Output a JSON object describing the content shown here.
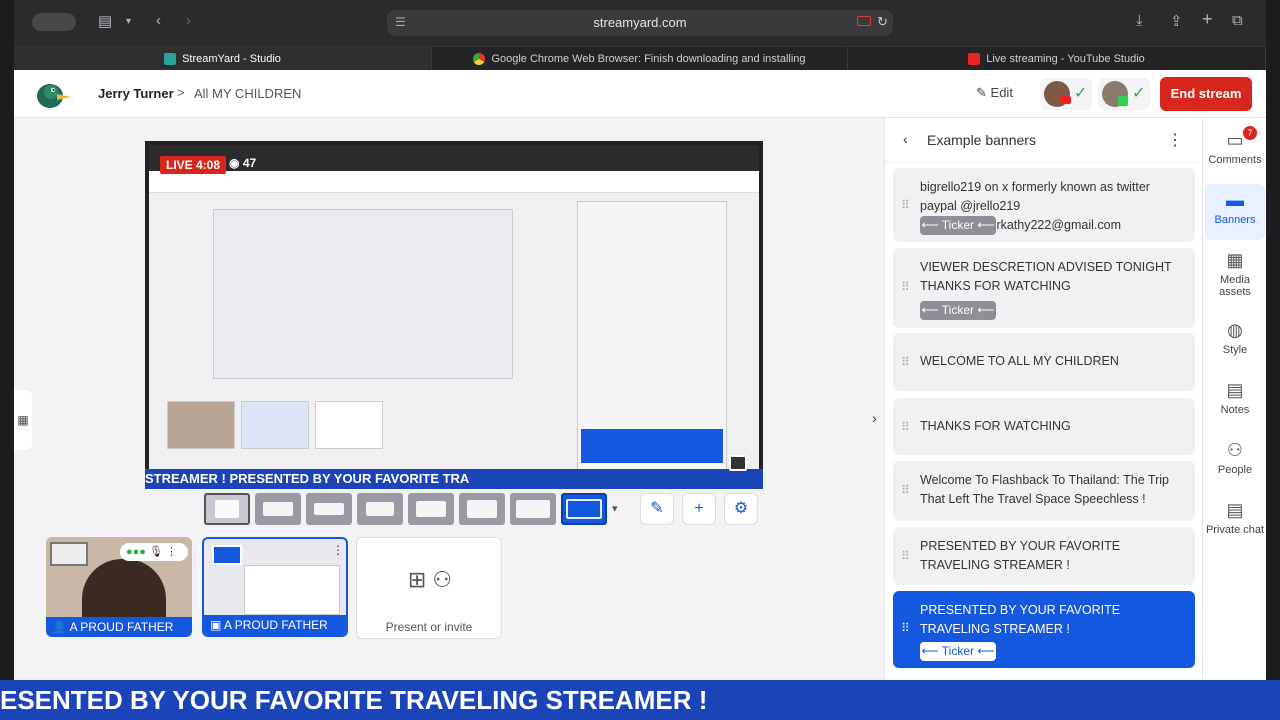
{
  "browser": {
    "url": "streamyard.com",
    "tabs": [
      {
        "label": "StreamYard - Studio",
        "active": true
      },
      {
        "label": "Google Chrome Web Browser: Finish downloading and installing",
        "active": false
      },
      {
        "label": "Live streaming - YouTube Studio",
        "active": false
      }
    ]
  },
  "header": {
    "user": "Jerry Turner",
    "separator": ">",
    "show": "All MY CHILDREN",
    "edit_label": "Edit",
    "end_stream_label": "End stream"
  },
  "stage": {
    "live_label": "LIVE 4:08",
    "viewer_count": "47",
    "banner_text": "STREAMER !          PRESENTED BY YOUR FAVORITE TRA"
  },
  "tiles": [
    {
      "label": "A PROUD FATHER"
    },
    {
      "label": "A PROUD FATHER"
    }
  ],
  "present_invite_label": "Present or invite",
  "panel": {
    "title": "Example banners",
    "banners": [
      {
        "text": "bigrello219 on x formerly known as twitter paypal @jrello219 applepaysisterkathy222@gmail.com",
        "ticker": "⟵ Ticker ⟵",
        "active": false
      },
      {
        "text": "VIEWER DESCRETION ADVISED TONIGHT THANKS FOR WATCHING",
        "ticker": "⟵ Ticker ⟵",
        "active": false
      },
      {
        "text": "WELCOME TO ALL MY CHILDREN",
        "ticker": null,
        "active": false
      },
      {
        "text": "THANKS FOR WATCHING",
        "ticker": null,
        "active": false
      },
      {
        "text": "Welcome To Flashback To Thailand: The Trip That Left The Travel Space Speechless !",
        "ticker": null,
        "active": false
      },
      {
        "text": "PRESENTED BY YOUR FAVORITE TRAVELING STREAMER !",
        "ticker": null,
        "active": false
      },
      {
        "text": "PRESENTED BY YOUR FAVORITE TRAVELING STREAMER !",
        "ticker": "⟵ Ticker ⟵",
        "active": true
      }
    ]
  },
  "rail": {
    "comments_label": "Comments",
    "comments_badge": "7",
    "banners_label": "Banners",
    "media_label": "Media assets",
    "style_label": "Style",
    "notes_label": "Notes",
    "people_label": "People",
    "chat_label": "Private chat"
  },
  "bottom_ticker": "ESENTED BY YOUR FAVORITE TRAVELING STREAMER !",
  "colors": {
    "accent": "#1558e0",
    "end_stream": "#d7261e",
    "ticker_bar": "#1a44b8"
  }
}
